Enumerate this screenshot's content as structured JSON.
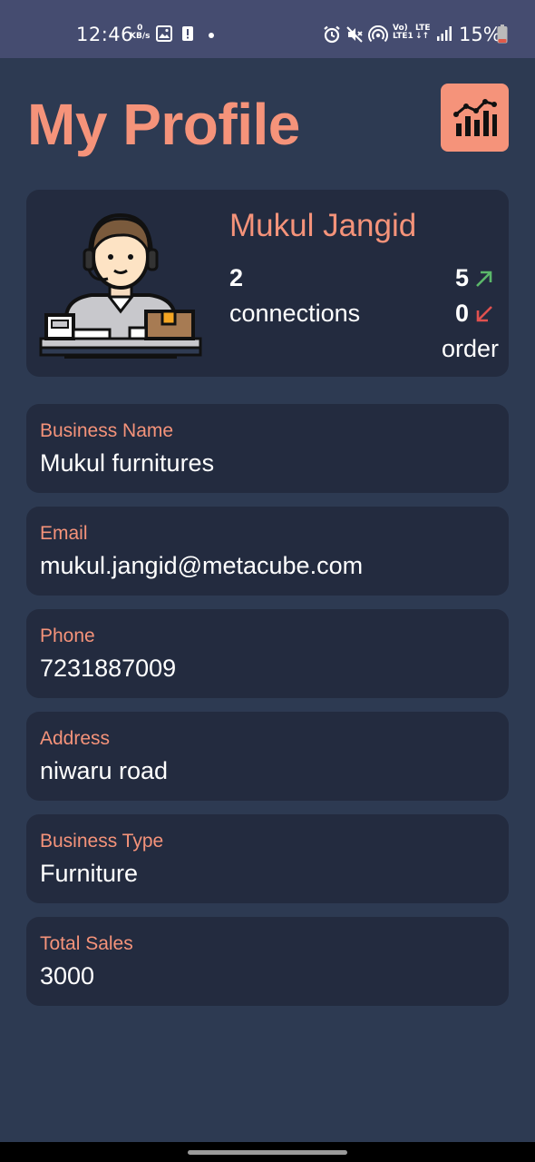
{
  "status_bar": {
    "time": "12:46",
    "kbs_value": "0",
    "kbs_unit": "KB/s",
    "network_top": "Vo)",
    "network_bottom": "LTE1",
    "network2_top": "LTE",
    "battery": "15%"
  },
  "header": {
    "title": "My Profile",
    "stats_icon": "bar-chart-icon"
  },
  "profile": {
    "name": "Mukul Jangid",
    "connections_count": "2",
    "connections_label": "connections",
    "orders_out": "5",
    "orders_in": "0",
    "orders_label": "order",
    "avatar_icon": "businessman-avatar-icon",
    "arrow_up_color": "#5bb86a",
    "arrow_down_color": "#e0514f"
  },
  "fields": [
    {
      "label": "Business Name",
      "value": "Mukul furnitures"
    },
    {
      "label": "Email",
      "value": "mukul.jangid@metacube.com"
    },
    {
      "label": "Phone",
      "value": "7231887009"
    },
    {
      "label": "Address",
      "value": "niwaru road"
    },
    {
      "label": "Business Type",
      "value": "Furniture"
    },
    {
      "label": "Total Sales",
      "value": "3000"
    }
  ],
  "colors": {
    "background": "#2d3a52",
    "card": "#232b3f",
    "accent": "#f5937a",
    "status_bar": "#454c70"
  }
}
